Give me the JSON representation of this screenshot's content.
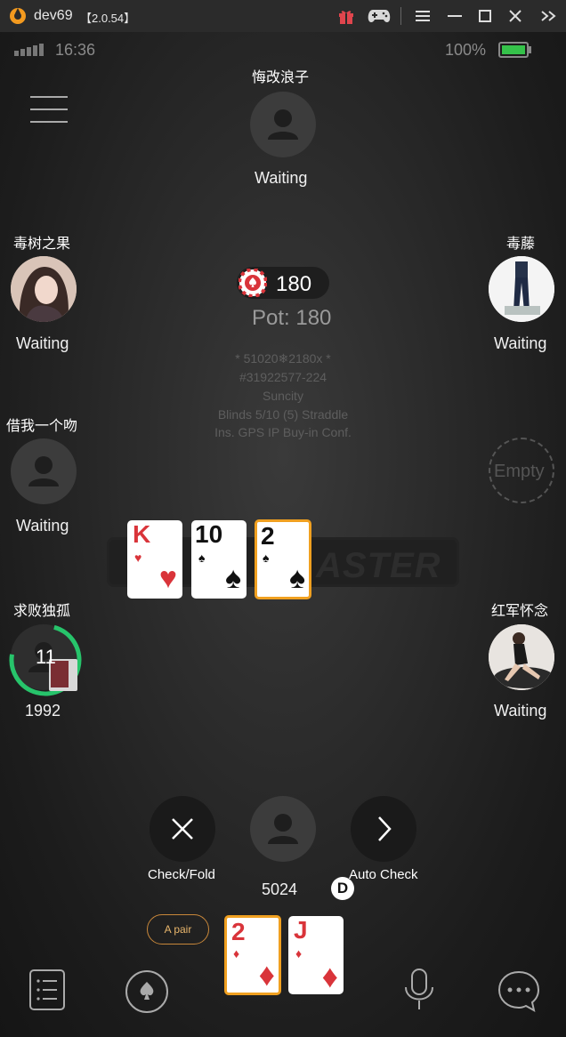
{
  "window": {
    "title": "dev69",
    "version": "【2.0.54】"
  },
  "status_bar": {
    "time": "16:36",
    "battery": "100%"
  },
  "players": {
    "top": {
      "name": "悔改浪子",
      "status": "Waiting",
      "avatar": "default-avatar"
    },
    "left_upper": {
      "name": "毒树之果",
      "status": "Waiting",
      "avatar": "photo-avatar"
    },
    "right_upper": {
      "name": "毒藤",
      "status": "Waiting",
      "avatar": "photo-avatar"
    },
    "left_middle": {
      "name": "借我一个吻",
      "status": "Waiting",
      "avatar": "default-avatar"
    },
    "right_middle": {
      "status": "Empty"
    },
    "left_lower": {
      "name": "求败独孤",
      "timer": "11",
      "stack": "1992",
      "avatar": "default-avatar"
    },
    "right_lower": {
      "name": "红军怀念",
      "status": "Waiting",
      "avatar": "photo-avatar"
    },
    "self": {
      "stack": "5024",
      "hand_label": "A pair"
    }
  },
  "pot": {
    "chip_amount": "180",
    "label": "Pot: 180"
  },
  "table_info": {
    "line1": "* 51020❄2180x *",
    "line2": "#31922577-224",
    "line3": "Suncity",
    "line4": "Blinds 5/10 (5) Straddle",
    "line5": "Ins. GPS IP Buy-in Conf."
  },
  "watermark": "ASTER",
  "board_cards": [
    {
      "rank": "K",
      "suit": "♥",
      "color": "red"
    },
    {
      "rank": "10",
      "suit": "♠",
      "color": "black"
    },
    {
      "rank": "2",
      "suit": "♠",
      "color": "black",
      "highlighted": true
    }
  ],
  "hole_cards": [
    {
      "rank": "2",
      "suit": "♦",
      "color": "red",
      "highlighted": true
    },
    {
      "rank": "J",
      "suit": "♦",
      "color": "red"
    }
  ],
  "actions": {
    "check_fold": "Check/Fold",
    "auto_check": "Auto Check",
    "dealer": "D"
  },
  "colors": {
    "accent_orange": "#f0a020",
    "timer_green": "#27c46b",
    "card_red": "#d9343a"
  }
}
